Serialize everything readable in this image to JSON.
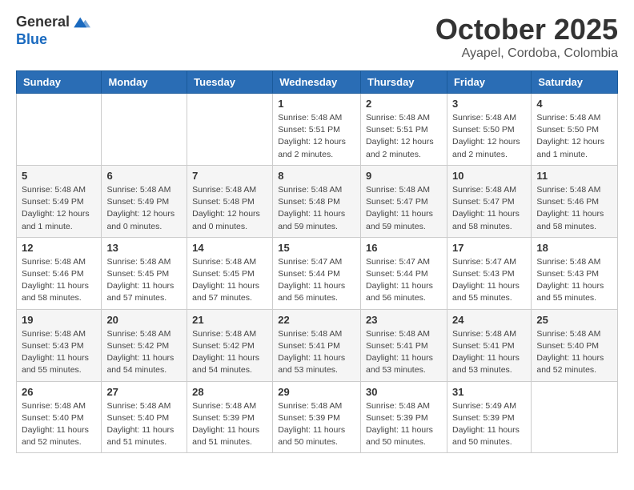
{
  "header": {
    "logo_general": "General",
    "logo_blue": "Blue",
    "month": "October 2025",
    "location": "Ayapel, Cordoba, Colombia"
  },
  "weekdays": [
    "Sunday",
    "Monday",
    "Tuesday",
    "Wednesday",
    "Thursday",
    "Friday",
    "Saturday"
  ],
  "weeks": [
    [
      {
        "day": "",
        "info": ""
      },
      {
        "day": "",
        "info": ""
      },
      {
        "day": "",
        "info": ""
      },
      {
        "day": "1",
        "info": "Sunrise: 5:48 AM\nSunset: 5:51 PM\nDaylight: 12 hours and 2 minutes."
      },
      {
        "day": "2",
        "info": "Sunrise: 5:48 AM\nSunset: 5:51 PM\nDaylight: 12 hours and 2 minutes."
      },
      {
        "day": "3",
        "info": "Sunrise: 5:48 AM\nSunset: 5:50 PM\nDaylight: 12 hours and 2 minutes."
      },
      {
        "day": "4",
        "info": "Sunrise: 5:48 AM\nSunset: 5:50 PM\nDaylight: 12 hours and 1 minute."
      }
    ],
    [
      {
        "day": "5",
        "info": "Sunrise: 5:48 AM\nSunset: 5:49 PM\nDaylight: 12 hours and 1 minute."
      },
      {
        "day": "6",
        "info": "Sunrise: 5:48 AM\nSunset: 5:49 PM\nDaylight: 12 hours and 0 minutes."
      },
      {
        "day": "7",
        "info": "Sunrise: 5:48 AM\nSunset: 5:48 PM\nDaylight: 12 hours and 0 minutes."
      },
      {
        "day": "8",
        "info": "Sunrise: 5:48 AM\nSunset: 5:48 PM\nDaylight: 11 hours and 59 minutes."
      },
      {
        "day": "9",
        "info": "Sunrise: 5:48 AM\nSunset: 5:47 PM\nDaylight: 11 hours and 59 minutes."
      },
      {
        "day": "10",
        "info": "Sunrise: 5:48 AM\nSunset: 5:47 PM\nDaylight: 11 hours and 58 minutes."
      },
      {
        "day": "11",
        "info": "Sunrise: 5:48 AM\nSunset: 5:46 PM\nDaylight: 11 hours and 58 minutes."
      }
    ],
    [
      {
        "day": "12",
        "info": "Sunrise: 5:48 AM\nSunset: 5:46 PM\nDaylight: 11 hours and 58 minutes."
      },
      {
        "day": "13",
        "info": "Sunrise: 5:48 AM\nSunset: 5:45 PM\nDaylight: 11 hours and 57 minutes."
      },
      {
        "day": "14",
        "info": "Sunrise: 5:48 AM\nSunset: 5:45 PM\nDaylight: 11 hours and 57 minutes."
      },
      {
        "day": "15",
        "info": "Sunrise: 5:47 AM\nSunset: 5:44 PM\nDaylight: 11 hours and 56 minutes."
      },
      {
        "day": "16",
        "info": "Sunrise: 5:47 AM\nSunset: 5:44 PM\nDaylight: 11 hours and 56 minutes."
      },
      {
        "day": "17",
        "info": "Sunrise: 5:47 AM\nSunset: 5:43 PM\nDaylight: 11 hours and 55 minutes."
      },
      {
        "day": "18",
        "info": "Sunrise: 5:48 AM\nSunset: 5:43 PM\nDaylight: 11 hours and 55 minutes."
      }
    ],
    [
      {
        "day": "19",
        "info": "Sunrise: 5:48 AM\nSunset: 5:43 PM\nDaylight: 11 hours and 55 minutes."
      },
      {
        "day": "20",
        "info": "Sunrise: 5:48 AM\nSunset: 5:42 PM\nDaylight: 11 hours and 54 minutes."
      },
      {
        "day": "21",
        "info": "Sunrise: 5:48 AM\nSunset: 5:42 PM\nDaylight: 11 hours and 54 minutes."
      },
      {
        "day": "22",
        "info": "Sunrise: 5:48 AM\nSunset: 5:41 PM\nDaylight: 11 hours and 53 minutes."
      },
      {
        "day": "23",
        "info": "Sunrise: 5:48 AM\nSunset: 5:41 PM\nDaylight: 11 hours and 53 minutes."
      },
      {
        "day": "24",
        "info": "Sunrise: 5:48 AM\nSunset: 5:41 PM\nDaylight: 11 hours and 53 minutes."
      },
      {
        "day": "25",
        "info": "Sunrise: 5:48 AM\nSunset: 5:40 PM\nDaylight: 11 hours and 52 minutes."
      }
    ],
    [
      {
        "day": "26",
        "info": "Sunrise: 5:48 AM\nSunset: 5:40 PM\nDaylight: 11 hours and 52 minutes."
      },
      {
        "day": "27",
        "info": "Sunrise: 5:48 AM\nSunset: 5:40 PM\nDaylight: 11 hours and 51 minutes."
      },
      {
        "day": "28",
        "info": "Sunrise: 5:48 AM\nSunset: 5:39 PM\nDaylight: 11 hours and 51 minutes."
      },
      {
        "day": "29",
        "info": "Sunrise: 5:48 AM\nSunset: 5:39 PM\nDaylight: 11 hours and 50 minutes."
      },
      {
        "day": "30",
        "info": "Sunrise: 5:48 AM\nSunset: 5:39 PM\nDaylight: 11 hours and 50 minutes."
      },
      {
        "day": "31",
        "info": "Sunrise: 5:49 AM\nSunset: 5:39 PM\nDaylight: 11 hours and 50 minutes."
      },
      {
        "day": "",
        "info": ""
      }
    ]
  ]
}
